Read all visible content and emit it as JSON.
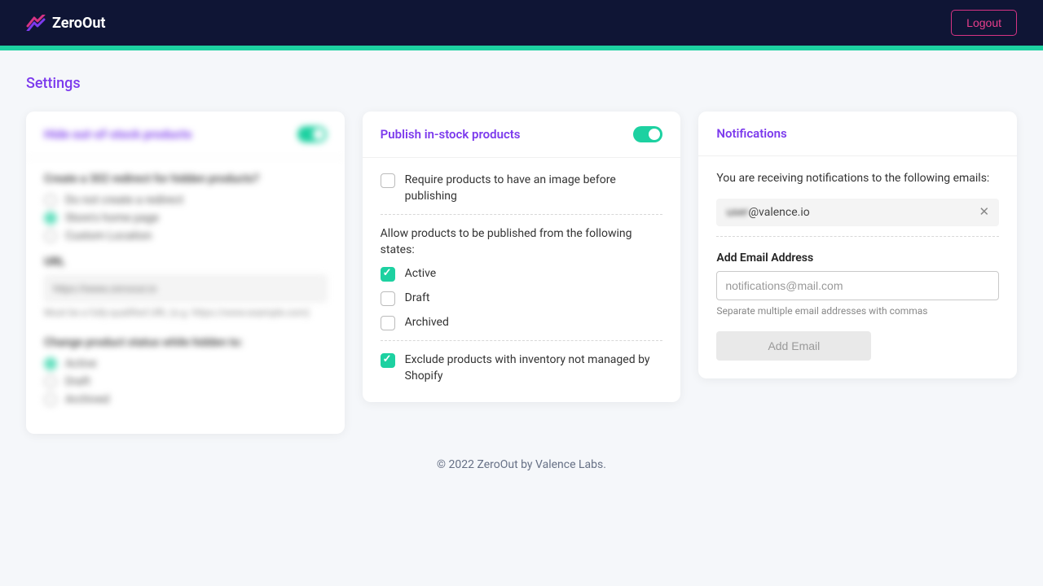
{
  "header": {
    "app_name": "ZeroOut",
    "logout_label": "Logout"
  },
  "page": {
    "title": "Settings"
  },
  "hide_card": {
    "title": "Hide out-of-stock products",
    "toggle_on": true,
    "redirect_label": "Create a 302 redirect for hidden products?",
    "redirect_options": [
      {
        "label": "Do not create a redirect",
        "checked": false
      },
      {
        "label": "Store's home page",
        "checked": true
      },
      {
        "label": "Custom Location",
        "checked": false
      }
    ],
    "url_label": "URL",
    "url_placeholder": "https://www.zeroout.io",
    "url_hint": "Must be a fully-qualified URL (e.g. https://www.example.com)",
    "status_label": "Change product status while hidden to:",
    "status_options": [
      {
        "label": "Active",
        "checked": true
      },
      {
        "label": "Draft",
        "checked": false
      },
      {
        "label": "Archived",
        "checked": false
      }
    ]
  },
  "publish_card": {
    "title": "Publish in-stock products",
    "toggle_on": true,
    "require_image_label": "Require products to have an image before publishing",
    "require_image_checked": false,
    "states_label": "Allow products to be published from the following states:",
    "states": [
      {
        "label": "Active",
        "checked": true
      },
      {
        "label": "Draft",
        "checked": false
      },
      {
        "label": "Archived",
        "checked": false
      }
    ],
    "exclude_label": "Exclude products with inventory not managed by Shopify",
    "exclude_checked": true
  },
  "notifications_card": {
    "title": "Notifications",
    "receiving_text": "You are receiving notifications to the following emails:",
    "emails": [
      {
        "prefix_blurred": "user",
        "domain": "@valence.io"
      }
    ],
    "add_label": "Add Email Address",
    "email_placeholder": "notifications@mail.com",
    "add_hint": "Separate multiple email addresses with commas",
    "add_button": "Add Email"
  },
  "footer": {
    "text": "© 2022 ZeroOut by Valence Labs."
  },
  "colors": {
    "accent": "#7c3aed",
    "green": "#1dd1a1",
    "pink": "#e83e8c",
    "navy": "#0f1535"
  }
}
